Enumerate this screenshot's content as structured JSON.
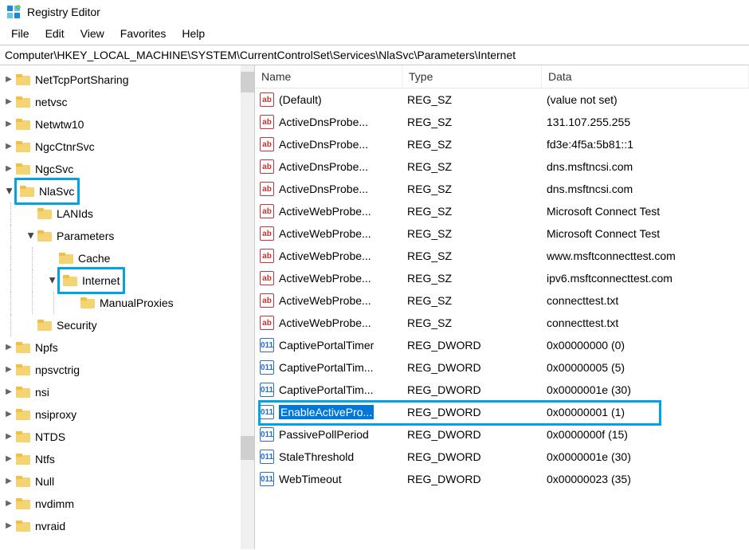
{
  "title": "Registry Editor",
  "menu": [
    "File",
    "Edit",
    "View",
    "Favorites",
    "Help"
  ],
  "address": "Computer\\HKEY_LOCAL_MACHINE\\SYSTEM\\CurrentControlSet\\Services\\NlaSvc\\Parameters\\Internet",
  "columns": {
    "name": "Name",
    "type": "Type",
    "data": "Data"
  },
  "tree": [
    {
      "label": "NetTcpPortSharing",
      "depth": 0,
      "exp": ">",
      "hl": false
    },
    {
      "label": "netvsc",
      "depth": 0,
      "exp": ">",
      "hl": false
    },
    {
      "label": "Netwtw10",
      "depth": 0,
      "exp": ">",
      "hl": false
    },
    {
      "label": "NgcCtnrSvc",
      "depth": 0,
      "exp": ">",
      "hl": false
    },
    {
      "label": "NgcSvc",
      "depth": 0,
      "exp": ">",
      "hl": false
    },
    {
      "label": "NlaSvc",
      "depth": 0,
      "exp": "v",
      "hl": true
    },
    {
      "label": "LANIds",
      "depth": 1,
      "exp": "",
      "hl": false
    },
    {
      "label": "Parameters",
      "depth": 1,
      "exp": "v",
      "hl": false
    },
    {
      "label": "Cache",
      "depth": 2,
      "exp": "",
      "hl": false
    },
    {
      "label": "Internet",
      "depth": 2,
      "exp": "v",
      "hl": true
    },
    {
      "label": "ManualProxies",
      "depth": 3,
      "exp": "",
      "hl": false
    },
    {
      "label": "Security",
      "depth": 1,
      "exp": "",
      "hl": false
    },
    {
      "label": "Npfs",
      "depth": 0,
      "exp": ">",
      "hl": false
    },
    {
      "label": "npsvctrig",
      "depth": 0,
      "exp": ">",
      "hl": false
    },
    {
      "label": "nsi",
      "depth": 0,
      "exp": ">",
      "hl": false
    },
    {
      "label": "nsiproxy",
      "depth": 0,
      "exp": ">",
      "hl": false
    },
    {
      "label": "NTDS",
      "depth": 0,
      "exp": ">",
      "hl": false
    },
    {
      "label": "Ntfs",
      "depth": 0,
      "exp": ">",
      "hl": false
    },
    {
      "label": "Null",
      "depth": 0,
      "exp": ">",
      "hl": false
    },
    {
      "label": "nvdimm",
      "depth": 0,
      "exp": ">",
      "hl": false
    },
    {
      "label": "nvraid",
      "depth": 0,
      "exp": ">",
      "hl": false
    }
  ],
  "values": [
    {
      "name": "(Default)",
      "type": "REG_SZ",
      "data": "(value not set)",
      "kind": "sz",
      "sel": false
    },
    {
      "name": "ActiveDnsProbe...",
      "type": "REG_SZ",
      "data": "131.107.255.255",
      "kind": "sz",
      "sel": false
    },
    {
      "name": "ActiveDnsProbe...",
      "type": "REG_SZ",
      "data": "fd3e:4f5a:5b81::1",
      "kind": "sz",
      "sel": false
    },
    {
      "name": "ActiveDnsProbe...",
      "type": "REG_SZ",
      "data": "dns.msftncsi.com",
      "kind": "sz",
      "sel": false
    },
    {
      "name": "ActiveDnsProbe...",
      "type": "REG_SZ",
      "data": "dns.msftncsi.com",
      "kind": "sz",
      "sel": false
    },
    {
      "name": "ActiveWebProbe...",
      "type": "REG_SZ",
      "data": "Microsoft Connect Test",
      "kind": "sz",
      "sel": false
    },
    {
      "name": "ActiveWebProbe...",
      "type": "REG_SZ",
      "data": "Microsoft Connect Test",
      "kind": "sz",
      "sel": false
    },
    {
      "name": "ActiveWebProbe...",
      "type": "REG_SZ",
      "data": "www.msftconnecttest.com",
      "kind": "sz",
      "sel": false
    },
    {
      "name": "ActiveWebProbe...",
      "type": "REG_SZ",
      "data": "ipv6.msftconnecttest.com",
      "kind": "sz",
      "sel": false
    },
    {
      "name": "ActiveWebProbe...",
      "type": "REG_SZ",
      "data": "connecttest.txt",
      "kind": "sz",
      "sel": false
    },
    {
      "name": "ActiveWebProbe...",
      "type": "REG_SZ",
      "data": "connecttest.txt",
      "kind": "sz",
      "sel": false
    },
    {
      "name": "CaptivePortalTimer",
      "type": "REG_DWORD",
      "data": "0x00000000 (0)",
      "kind": "dw",
      "sel": false
    },
    {
      "name": "CaptivePortalTim...",
      "type": "REG_DWORD",
      "data": "0x00000005 (5)",
      "kind": "dw",
      "sel": false
    },
    {
      "name": "CaptivePortalTim...",
      "type": "REG_DWORD",
      "data": "0x0000001e (30)",
      "kind": "dw",
      "sel": false
    },
    {
      "name": "EnableActivePro...",
      "type": "REG_DWORD",
      "data": "0x00000001 (1)",
      "kind": "dw",
      "sel": true
    },
    {
      "name": "PassivePollPeriod",
      "type": "REG_DWORD",
      "data": "0x0000000f (15)",
      "kind": "dw",
      "sel": false
    },
    {
      "name": "StaleThreshold",
      "type": "REG_DWORD",
      "data": "0x0000001e (30)",
      "kind": "dw",
      "sel": false
    },
    {
      "name": "WebTimeout",
      "type": "REG_DWORD",
      "data": "0x00000023 (35)",
      "kind": "dw",
      "sel": false
    }
  ],
  "icon_labels": {
    "sz": "ab",
    "dw": "011"
  }
}
